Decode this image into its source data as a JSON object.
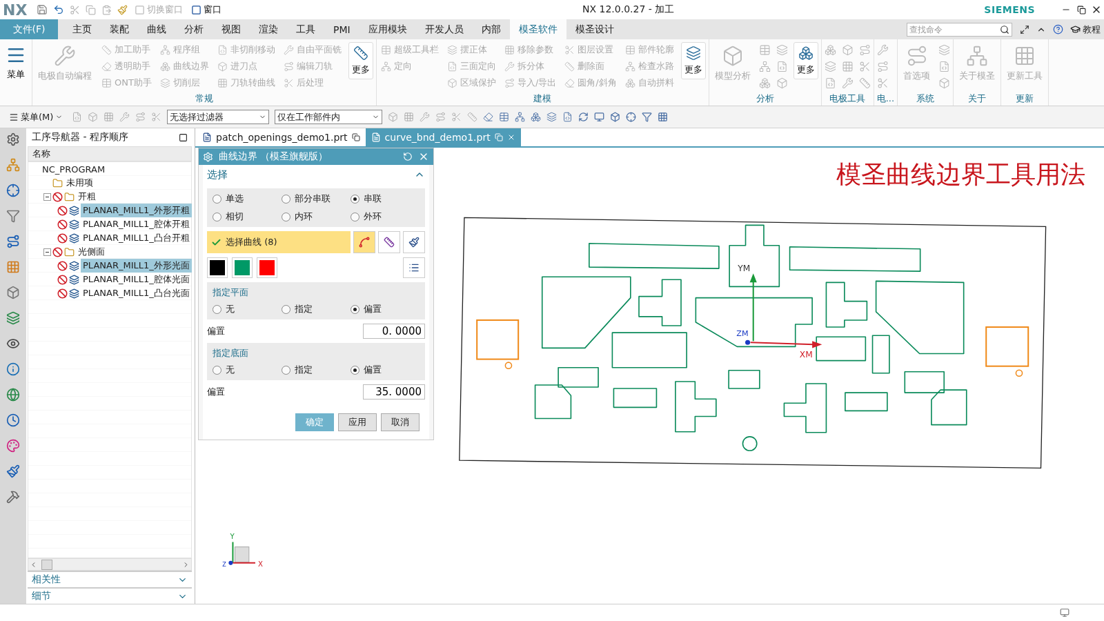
{
  "quick_access": {
    "logo": "NX",
    "items": [
      {
        "label": "切换窗口",
        "disabled": true
      },
      {
        "label": "窗口",
        "disabled": false
      }
    ]
  },
  "window": {
    "title": "NX 12.0.0.27 - 加工",
    "brand": "SIEMENS"
  },
  "menu_tabs": [
    {
      "label": "文件(F)",
      "kind": "file",
      "selected": false
    },
    {
      "label": "主页",
      "kind": "tab",
      "selected": false
    },
    {
      "label": "装配",
      "kind": "tab",
      "selected": false
    },
    {
      "label": "曲线",
      "kind": "tab",
      "selected": false
    },
    {
      "label": "分析",
      "kind": "tab",
      "selected": false
    },
    {
      "label": "视图",
      "kind": "tab",
      "selected": false
    },
    {
      "label": "渲染",
      "kind": "tab",
      "selected": false
    },
    {
      "label": "工具",
      "kind": "tab",
      "selected": false
    },
    {
      "label": "PMI",
      "kind": "tab",
      "selected": false
    },
    {
      "label": "应用模块",
      "kind": "tab",
      "selected": false
    },
    {
      "label": "开发人员",
      "kind": "tab",
      "selected": false
    },
    {
      "label": "内部",
      "kind": "tab",
      "selected": false
    },
    {
      "label": "模圣软件",
      "kind": "tab",
      "selected": true
    },
    {
      "label": "模圣设计",
      "kind": "tab",
      "selected": false
    }
  ],
  "search": {
    "placeholder": "查找命令"
  },
  "help": {
    "label": "教程"
  },
  "ribbon": [
    {
      "columns": [
        {
          "kind": "large",
          "label": "菜单",
          "disabled": false
        }
      ]
    },
    {
      "label": "常规",
      "columns": [
        {
          "kind": "large",
          "label": "电极自动编程",
          "disabled": true
        },
        {
          "kind": "stack",
          "items": [
            {
              "label": "加工助手",
              "disabled": true
            },
            {
              "label": "透明助手",
              "disabled": true
            },
            {
              "label": "ONT助手",
              "disabled": true
            }
          ]
        },
        {
          "kind": "stack",
          "items": [
            {
              "label": "程序组",
              "disabled": true
            },
            {
              "label": "曲线边界",
              "disabled": true
            },
            {
              "label": "切削层",
              "disabled": true
            }
          ]
        },
        {
          "kind": "stack",
          "items": [
            {
              "label": "非切削移动",
              "disabled": true
            },
            {
              "label": "进刀点",
              "disabled": true
            },
            {
              "label": "刀轨转曲线",
              "disabled": true
            }
          ]
        },
        {
          "kind": "stack",
          "items": [
            {
              "label": "自由平面铣",
              "disabled": true
            },
            {
              "label": "编辑刀轨",
              "disabled": true
            },
            {
              "label": "后处理",
              "disabled": true
            }
          ]
        },
        {
          "kind": "large",
          "label": "更多",
          "disabled": false
        }
      ]
    },
    {
      "label": "建模",
      "columns": [
        {
          "kind": "stack",
          "items": [
            {
              "label": "超级工具栏",
              "disabled": true
            },
            {
              "label": "定向",
              "disabled": true
            }
          ]
        },
        {
          "kind": "stack",
          "items": [
            {
              "label": "摆正体",
              "disabled": true
            },
            {
              "label": "三面定向",
              "disabled": true
            },
            {
              "label": "区域保护",
              "disabled": true
            }
          ]
        },
        {
          "kind": "stack",
          "items": [
            {
              "label": "移除参数",
              "disabled": true
            },
            {
              "label": "拆分体",
              "disabled": true
            },
            {
              "label": "导入/导出",
              "disabled": true
            }
          ]
        },
        {
          "kind": "stack",
          "items": [
            {
              "label": "图层设置",
              "disabled": true
            },
            {
              "label": "删除面",
              "disabled": true
            },
            {
              "label": "圆角/斜角",
              "disabled": true
            }
          ]
        },
        {
          "kind": "stack",
          "items": [
            {
              "label": "部件轮廓",
              "disabled": true
            },
            {
              "label": "检查水路",
              "disabled": true
            },
            {
              "label": "自动拼料",
              "disabled": true
            }
          ]
        },
        {
          "kind": "large",
          "label": "更多",
          "disabled": false
        }
      ]
    },
    {
      "label": "分析",
      "columns": [
        {
          "kind": "large",
          "label": "模型分析",
          "disabled": true
        },
        {
          "kind": "icons"
        },
        {
          "kind": "icons"
        },
        {
          "kind": "large",
          "label": "更多",
          "disabled": false
        }
      ]
    },
    {
      "label": "电极工具",
      "columns": [
        {
          "kind": "icons"
        },
        {
          "kind": "icons"
        },
        {
          "kind": "icons"
        }
      ]
    },
    {
      "label": "电...",
      "columns": [
        {
          "kind": "icons"
        }
      ]
    },
    {
      "label": "系统",
      "columns": [
        {
          "kind": "large",
          "label": "首选项",
          "disabled": true
        },
        {
          "kind": "icons"
        }
      ]
    },
    {
      "label": "关于",
      "columns": [
        {
          "kind": "large",
          "label": "关于模圣",
          "disabled": true
        }
      ]
    },
    {
      "label": "更新",
      "columns": [
        {
          "kind": "large",
          "label": "更新工具",
          "disabled": true
        }
      ]
    }
  ],
  "toolbar": {
    "menu": "菜单(M)",
    "filters": [
      "无选择过滤器",
      "仅在工作部件内"
    ]
  },
  "navigator": {
    "title": "工序导航器 - 程序顺序",
    "column": "名称",
    "tree": [
      {
        "label": "NC_PROGRAM",
        "selected": false,
        "children": [
          {
            "label": "未用项",
            "kind": "unused",
            "selected": false
          },
          {
            "label": "开粗",
            "kind": "group",
            "selected": false,
            "expanded": true,
            "children": [
              {
                "label": "PLANAR_MILL1_外形开粗",
                "kind": "operation",
                "selected": true
              },
              {
                "label": "PLANAR_MILL1_腔体开粗",
                "kind": "operation",
                "selected": false
              },
              {
                "label": "PLANAR_MILL1_凸台开粗",
                "kind": "operation",
                "selected": false
              }
            ]
          },
          {
            "label": "光侧面",
            "kind": "group",
            "selected": false,
            "expanded": true,
            "children": [
              {
                "label": "PLANAR_MILL1_外形光面",
                "kind": "operation",
                "selected": true
              },
              {
                "label": "PLANAR_MILL1_腔体光面",
                "kind": "operation",
                "selected": false
              },
              {
                "label": "PLANAR_MILL1_凸台光面",
                "kind": "operation",
                "selected": false
              }
            ]
          }
        ]
      }
    ],
    "panels": [
      {
        "label": "相关性",
        "expanded": false
      },
      {
        "label": "细节",
        "expanded": false
      }
    ]
  },
  "doc_tabs": [
    {
      "label": "patch_openings_demo1.prt",
      "selected": false
    },
    {
      "label": "curve_bnd_demo1.prt",
      "selected": true
    }
  ],
  "dialog": {
    "title": "曲线边界 （模圣旗舰版）",
    "section": "选择",
    "modes": [
      {
        "label": "单选",
        "selected": false
      },
      {
        "label": "部分串联",
        "selected": false
      },
      {
        "label": "串联",
        "selected": true
      },
      {
        "label": "相切",
        "selected": false
      },
      {
        "label": "内环",
        "selected": false
      },
      {
        "label": "外环",
        "selected": false
      }
    ],
    "select_curve": {
      "label": "选择曲线 (8)",
      "done": true
    },
    "swatches": [
      {
        "color": "#000000"
      },
      {
        "color": "#009966"
      },
      {
        "color": "#ff0000"
      }
    ],
    "groups": [
      {
        "title": "指定平面",
        "options": [
          {
            "label": "无",
            "selected": false
          },
          {
            "label": "指定",
            "selected": false
          },
          {
            "label": "偏置",
            "selected": true
          }
        ],
        "offset_label": "偏置",
        "offset_value": "0. 0000"
      },
      {
        "title": "指定底面",
        "options": [
          {
            "label": "无",
            "selected": false
          },
          {
            "label": "指定",
            "selected": false
          },
          {
            "label": "偏置",
            "selected": true
          }
        ],
        "offset_label": "偏置",
        "offset_value": "35. 0000"
      }
    ],
    "buttons": [
      {
        "label": "确定",
        "kind": "primary"
      },
      {
        "label": "应用",
        "kind": "normal"
      },
      {
        "label": "取消",
        "kind": "normal"
      }
    ]
  },
  "canvas": {
    "title": "模圣曲线边界工具用法",
    "work_axes": {
      "x": "XM",
      "y": "YM",
      "z": "ZM"
    },
    "triad": {
      "x": "X",
      "y": "Y",
      "z": "Z"
    }
  }
}
